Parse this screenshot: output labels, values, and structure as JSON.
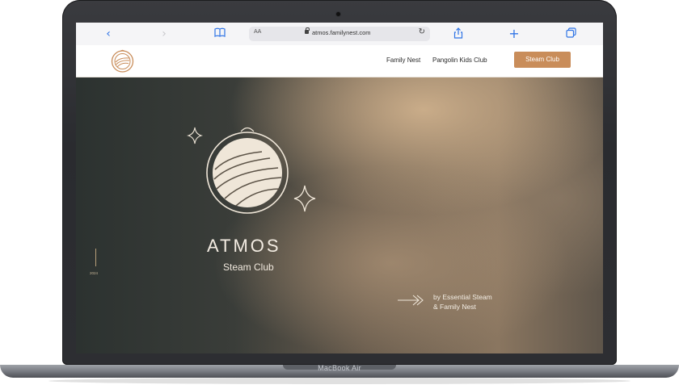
{
  "browser": {
    "address_size_label": "AA",
    "url": "atmos.familynest.com"
  },
  "site": {
    "nav": {
      "family_nest": "Family Nest",
      "pangolin_kids_club": "Pangolin Kids Club",
      "steam_club_button": "Steam Club"
    },
    "hero": {
      "title": "ATMOS",
      "subtitle": "Steam Club",
      "year": "2024",
      "byline_line1": "by Essential Steam",
      "byline_line2": "& Family Nest"
    }
  },
  "device": {
    "model": "MacBook Air"
  },
  "colors": {
    "accent": "#c98d5a",
    "hero_text": "#f3ece2",
    "browser_blue": "#2f74e6"
  },
  "icons": [
    "back-chevron-icon",
    "forward-chevron-icon",
    "bookmarks-book-icon",
    "lock-icon",
    "reload-icon",
    "share-icon",
    "new-tab-plus-icon",
    "tabs-overview-icon",
    "logo-emblem-icon",
    "sparkle-icon",
    "arrow-right-icon"
  ]
}
